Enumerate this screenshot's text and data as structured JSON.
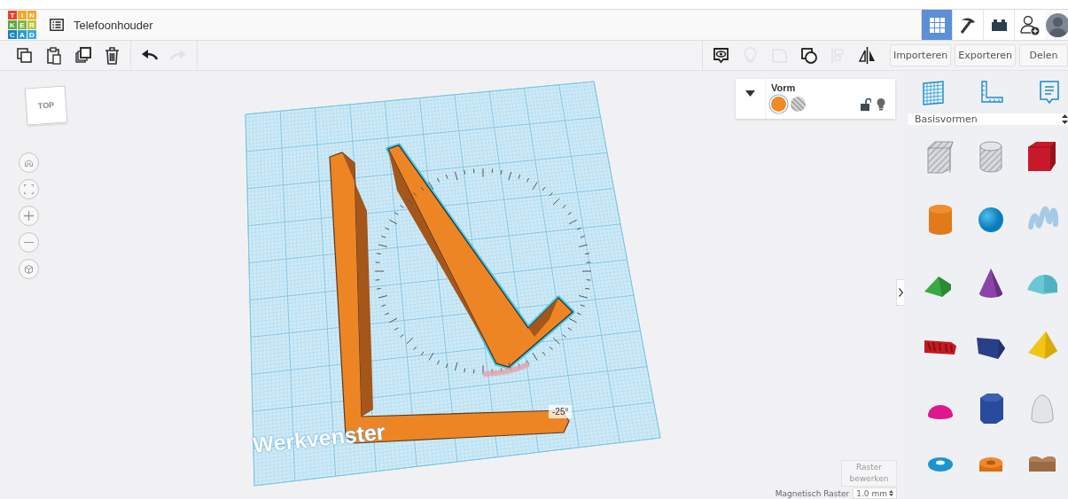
{
  "header": {
    "logo_letters": [
      "T",
      "I",
      "N",
      "K",
      "E",
      "R",
      "C",
      "A",
      "D"
    ],
    "title": "Telefoonhouder",
    "view_tabs": [
      {
        "kind": "design",
        "selected": true
      },
      {
        "kind": "codeblocks",
        "selected": false
      },
      {
        "kind": "bricks",
        "selected": false
      }
    ]
  },
  "toolbar": {
    "edit_tools": [
      {
        "kind": "copy",
        "disabled": false
      },
      {
        "kind": "paste",
        "disabled": false
      },
      {
        "kind": "duplicate",
        "disabled": false
      },
      {
        "kind": "delete",
        "disabled": false
      },
      {
        "kind": "undo",
        "disabled": false
      },
      {
        "kind": "redo",
        "disabled": true
      }
    ],
    "shape_tools": [
      {
        "kind": "notes",
        "disabled": false
      },
      {
        "kind": "light",
        "disabled": true
      },
      {
        "kind": "group",
        "disabled": true
      },
      {
        "kind": "ungroup",
        "disabled": false
      },
      {
        "kind": "align",
        "disabled": true
      },
      {
        "kind": "mirror",
        "disabled": false
      }
    ],
    "actions": [
      "Importeren",
      "Exporteren",
      "Delen"
    ]
  },
  "view_cube": {
    "label": "TOP"
  },
  "shape_panel": {
    "title": "Vorm",
    "modes": [
      {
        "kind": "solid",
        "selected": true,
        "color": "#f08a24"
      },
      {
        "kind": "hole",
        "selected": false
      }
    ],
    "locked": false
  },
  "workplane": {
    "label": "Werkvenster",
    "rotation_reading": "-25°"
  },
  "edit_grid_button": "Raster bewerken",
  "snap_grid": {
    "label": "Magnetisch Raster",
    "value": "1.0 mm"
  },
  "library": {
    "panel_tabs": [
      {
        "kind": "workplane",
        "selected": false
      },
      {
        "kind": "ruler",
        "selected": false
      },
      {
        "kind": "notes",
        "selected": false
      }
    ],
    "category": "Basisvormen",
    "shapes": [
      {
        "kind": "box-hole"
      },
      {
        "kind": "cylinder-hole"
      },
      {
        "kind": "box"
      },
      {
        "kind": "cylinder"
      },
      {
        "kind": "sphere"
      },
      {
        "kind": "scribble"
      },
      {
        "kind": "roof"
      },
      {
        "kind": "cone"
      },
      {
        "kind": "round-roof"
      },
      {
        "kind": "text"
      },
      {
        "kind": "wedge"
      },
      {
        "kind": "pyramid"
      },
      {
        "kind": "half-sphere"
      },
      {
        "kind": "polygon"
      },
      {
        "kind": "paraboloid"
      },
      {
        "kind": "torus"
      },
      {
        "kind": "tube"
      },
      {
        "kind": "heart"
      }
    ]
  }
}
